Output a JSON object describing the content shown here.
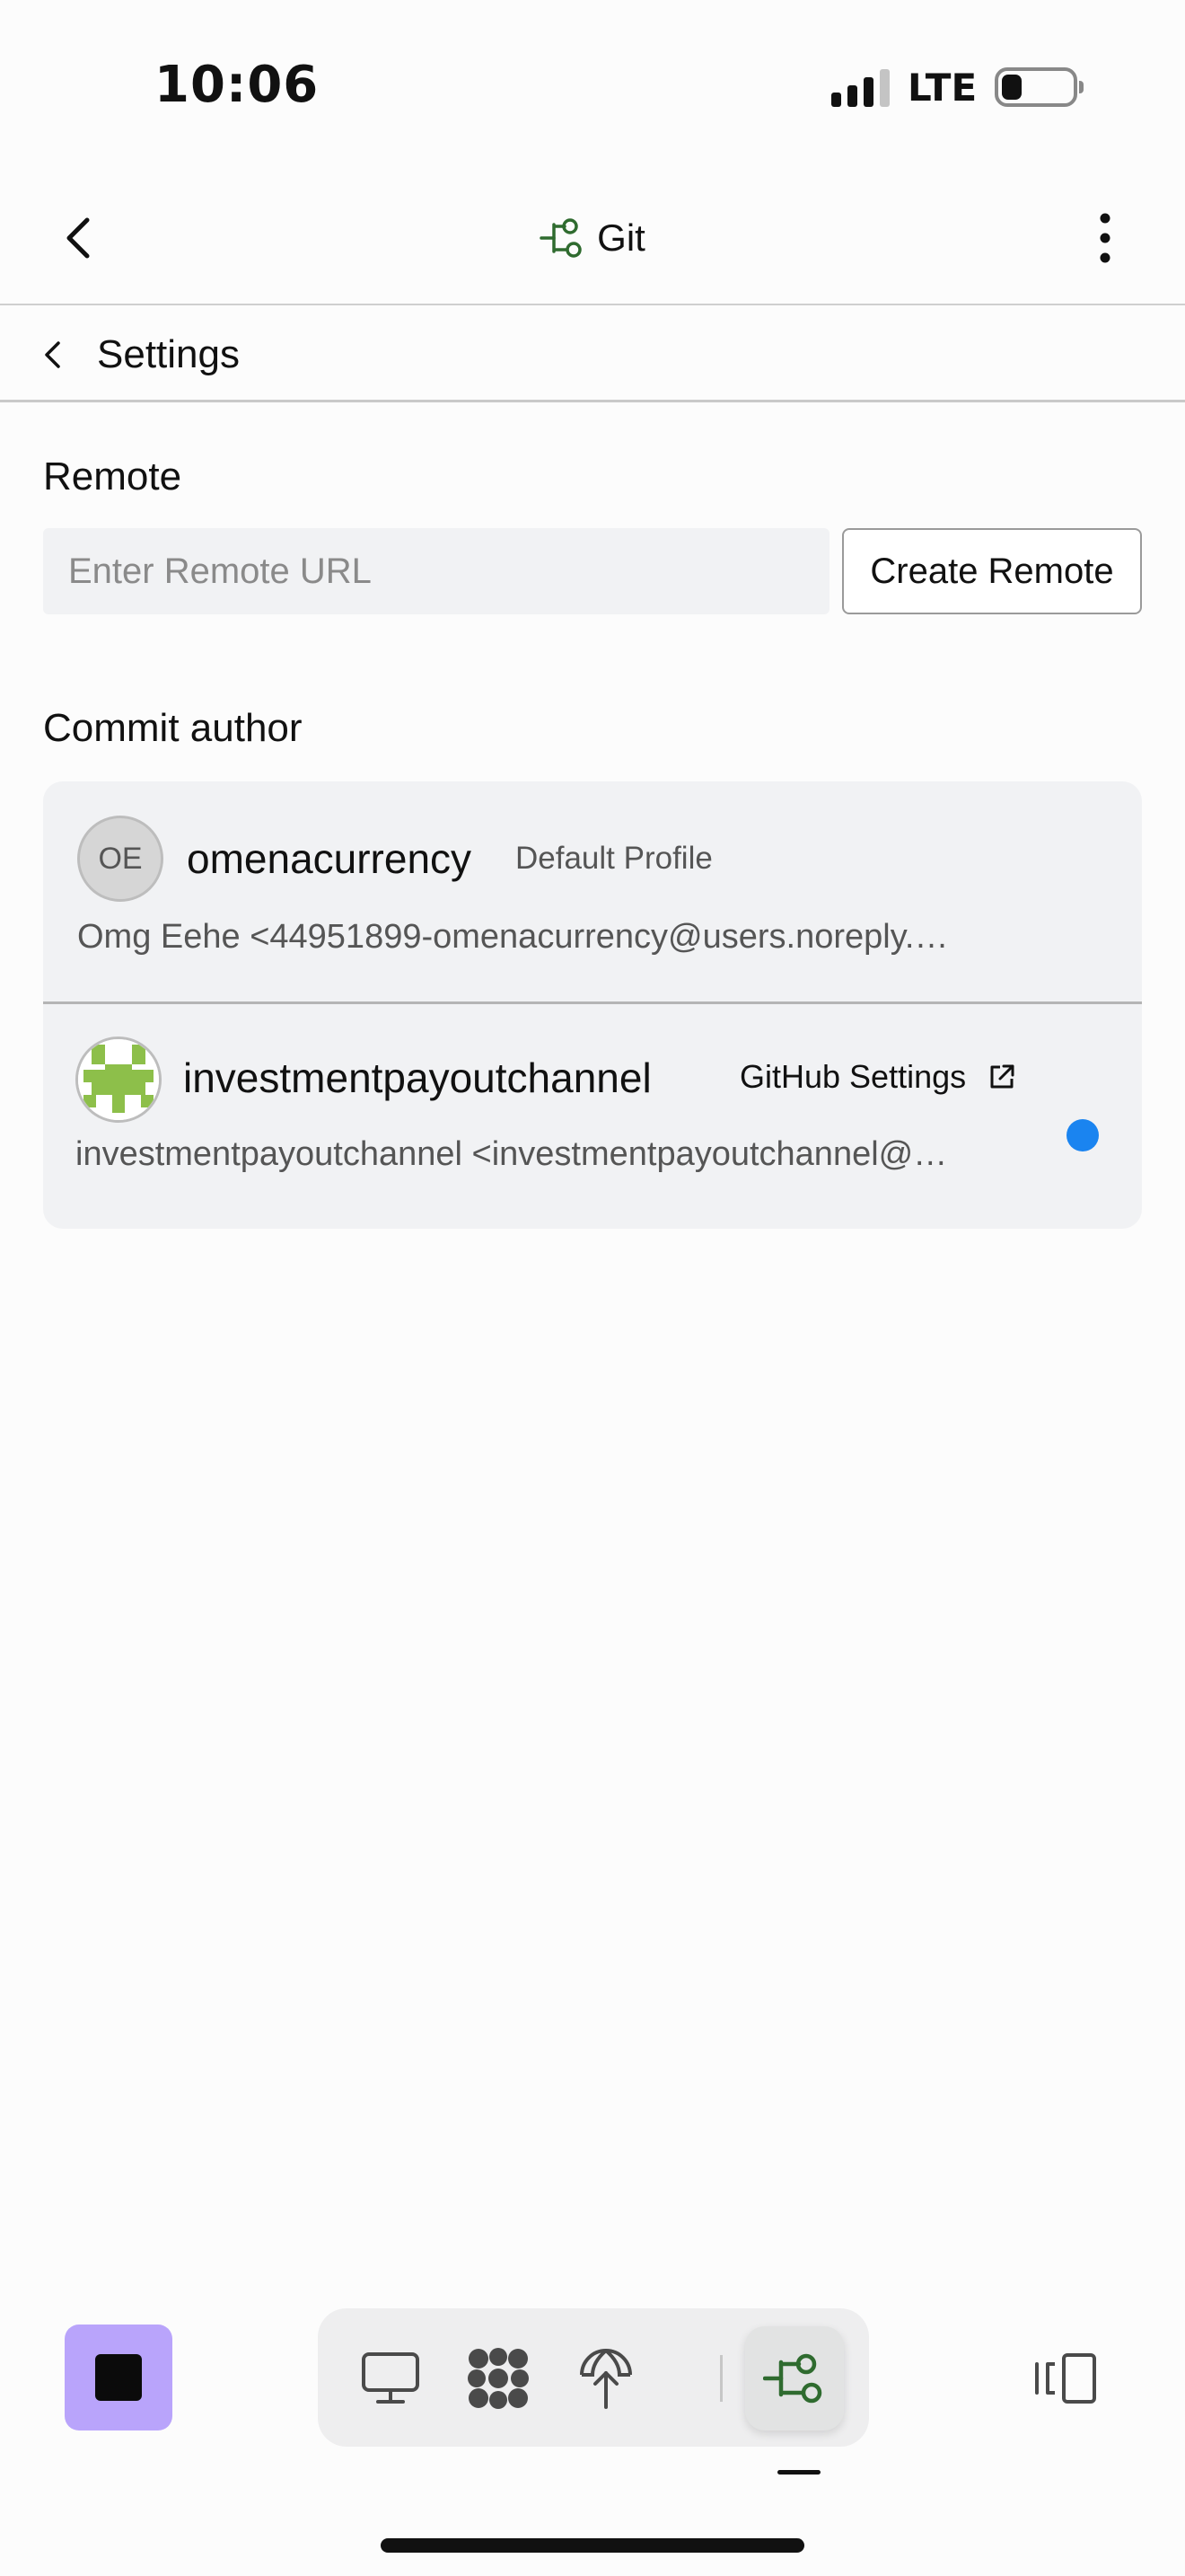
{
  "status_bar": {
    "time": "10:06",
    "network": "LTE"
  },
  "header": {
    "title": "Git",
    "title_icon": "git-branch-icon",
    "accent_color": "#2f6b2f"
  },
  "sub_header": {
    "title": "Settings"
  },
  "remote": {
    "label": "Remote",
    "input_placeholder": "Enter Remote URL",
    "input_value": "",
    "create_button": "Create Remote"
  },
  "commit_author": {
    "label": "Commit author",
    "profiles": [
      {
        "initials": "OE",
        "username": "omenacurrency",
        "tag": "Default Profile",
        "email": "Omg Eehe <44951899-omenacurrency@users.noreply.…",
        "selected": false
      },
      {
        "username": "investmentpayoutchannel",
        "link_label": "GitHub Settings",
        "link_icon": "external-link-icon",
        "email": "investmentpayoutchannel <investmentpayoutchannel@…",
        "selected": true,
        "avatar_color": "#8dbf4a"
      }
    ]
  },
  "bottom_bar": {
    "stop_color": "#b9a4fb",
    "nav_items": [
      {
        "icon": "monitor-icon",
        "active": false
      },
      {
        "icon": "flower-icon",
        "active": false
      },
      {
        "icon": "globe-upload-icon",
        "active": false
      },
      {
        "icon": "git-branch-icon",
        "active": true
      }
    ],
    "selected_dot_color": "#1a84f0"
  }
}
